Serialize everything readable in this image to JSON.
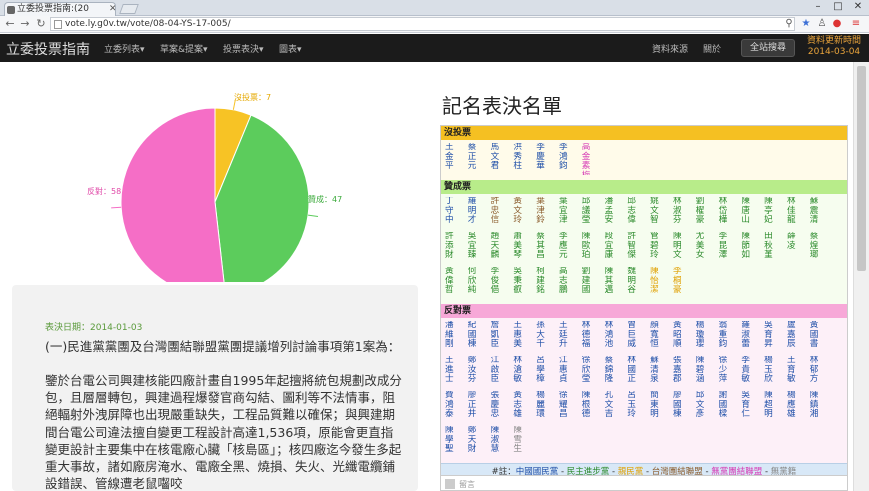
{
  "browser": {
    "tab_title": "立委投票指南:(20",
    "url": "vote.ly.g0v.tw/vote/08-04-YS-17-005/"
  },
  "navbar": {
    "brand": "立委投票指南",
    "menu": [
      "立委列表▾",
      "草案&提案▾",
      "投票表決▾",
      "圖表▾"
    ],
    "data_source": "資料來源",
    "about": "關於",
    "search": "全站搜尋",
    "update_label": "資料更新時間",
    "update_date": "2014-03-04"
  },
  "chart_data": {
    "type": "pie",
    "slices": [
      {
        "label": "沒投票",
        "value": 7,
        "color": "#f7c325"
      },
      {
        "label": "贊成",
        "value": 47,
        "color": "#5ccc5c"
      },
      {
        "label": "反對",
        "value": 58,
        "color": "#f56ec6"
      }
    ],
    "labels_text": [
      "沒投票：7",
      "贊成：47",
      "反對：58"
    ]
  },
  "vote": {
    "date": "表決日期：2014-01-03",
    "title": "(一)民進黨黨團及台灣團結聯盟黨團提議增列討論事項第1案為：",
    "body": "鑒於台電公司興建核能四廠計畫自1995年起擅將統包規劃改成分包，且層層轉包，興建過程爆發官商勾結、圖利等不法情事，阻絕輻射外洩屏障也出現嚴重缺失，工程品質難以確保；與興建期間台電公司違法擅自變更工程設計高達1,536項，原能會更直指變更設計主要集中在核電廠心臟「核島區」；核四廠迄今發生多起重大事故，諸如廠房淹水、電廠全黑、燒損、失火、光纖電纜鋪設錯誤、管線遭老鼠囓咬"
  },
  "roster": {
    "title": "記名表決名單",
    "sections": [
      {
        "label": "沒投票",
        "color": "#f5c022",
        "body_bg": "#fffbea",
        "names": [
          {
            "n": "王金平",
            "p": "kmt"
          },
          {
            "n": "蔡正元",
            "p": "kmt"
          },
          {
            "n": "馬文君",
            "p": "kmt"
          },
          {
            "n": "洪秀柱",
            "p": "kmt"
          },
          {
            "n": "李慶華",
            "p": "kmt"
          },
          {
            "n": "李鴻鈞",
            "p": "kmt"
          },
          {
            "n": "高金素梅",
            "p": "npsu"
          }
        ]
      },
      {
        "label": "贊成票",
        "color": "#b8ec8a",
        "body_bg": "#f6fdef",
        "names": [
          {
            "n": "丁守中",
            "p": "kmt"
          },
          {
            "n": "羅明才",
            "p": "kmt"
          },
          {
            "n": "許忠信",
            "p": "tsu"
          },
          {
            "n": "黃文玲",
            "p": "tsu"
          },
          {
            "n": "葉津鈴",
            "p": "tsu"
          },
          {
            "n": "葉宜津",
            "p": "dpp"
          },
          {
            "n": "邱議瑩",
            "p": "dpp"
          },
          {
            "n": "潘孟安",
            "p": "dpp"
          },
          {
            "n": "邱志偉",
            "p": "dpp"
          },
          {
            "n": "姚文智",
            "p": "dpp"
          },
          {
            "n": "林淑芬",
            "p": "dpp"
          },
          {
            "n": "劉櫂豪",
            "p": "dpp"
          },
          {
            "n": "林岱樺",
            "p": "dpp"
          },
          {
            "n": "陳唐山",
            "p": "dpp"
          },
          {
            "n": "陳亭妃",
            "p": "dpp"
          },
          {
            "n": "林佳龍",
            "p": "dpp"
          },
          {
            "n": "蘇震清",
            "p": "dpp"
          },
          {
            "n": "許添財",
            "p": "dpp"
          },
          {
            "n": "吳宜臻",
            "p": "dpp"
          },
          {
            "n": "趙天麟",
            "p": "dpp"
          },
          {
            "n": "蕭美琴",
            "p": "dpp"
          },
          {
            "n": "蔡其昌",
            "p": "dpp"
          },
          {
            "n": "李應元",
            "p": "dpp"
          },
          {
            "n": "陳歐珀",
            "p": "dpp"
          },
          {
            "n": "段宜康",
            "p": "dpp"
          },
          {
            "n": "許智傑",
            "p": "dpp"
          },
          {
            "n": "管碧玲",
            "p": "dpp"
          },
          {
            "n": "陳明文",
            "p": "dpp"
          },
          {
            "n": "尤美女",
            "p": "dpp"
          },
          {
            "n": "李昆澤",
            "p": "dpp"
          },
          {
            "n": "陳節如",
            "p": "dpp"
          },
          {
            "n": "田秋堇",
            "p": "dpp"
          },
          {
            "n": "薛凌",
            "p": "dpp"
          },
          {
            "n": "蔡煌瑯",
            "p": "dpp"
          },
          {
            "n": "黃偉哲",
            "p": "dpp"
          },
          {
            "n": "何欣純",
            "p": "dpp"
          },
          {
            "n": "李俊俋",
            "p": "dpp"
          },
          {
            "n": "吳秉叡",
            "p": "dpp"
          },
          {
            "n": "柯建銘",
            "p": "dpp"
          },
          {
            "n": "高志鵬",
            "p": "dpp"
          },
          {
            "n": "劉建國",
            "p": "dpp"
          },
          {
            "n": "陳其邁",
            "p": "dpp"
          },
          {
            "n": "魏明谷",
            "p": "dpp"
          },
          {
            "n": "陳怡潔",
            "p": "pfp"
          },
          {
            "n": "李桐豪",
            "p": "pfp"
          }
        ]
      },
      {
        "label": "反對票",
        "color": "#f7a8d8",
        "body_bg": "#fdf0f8",
        "names": [
          {
            "n": "潘維剛",
            "p": "kmt"
          },
          {
            "n": "紀國棟",
            "p": "kmt"
          },
          {
            "n": "詹凱臣",
            "p": "kmt"
          },
          {
            "n": "王惠美",
            "p": "kmt"
          },
          {
            "n": "孫大千",
            "p": "kmt"
          },
          {
            "n": "王廷升",
            "p": "kmt"
          },
          {
            "n": "林德福",
            "p": "kmt"
          },
          {
            "n": "林鴻池",
            "p": "kmt"
          },
          {
            "n": "曾巨威",
            "p": "kmt"
          },
          {
            "n": "顏寬恒",
            "p": "kmt"
          },
          {
            "n": "黃昭順",
            "p": "kmt"
          },
          {
            "n": "楊瓊瓔",
            "p": "kmt"
          },
          {
            "n": "翁重鈞",
            "p": "kmt"
          },
          {
            "n": "羅淑蕾",
            "p": "kmt"
          },
          {
            "n": "吳育昇",
            "p": "kmt"
          },
          {
            "n": "盧嘉辰",
            "p": "kmt"
          },
          {
            "n": "黃國書",
            "p": "kmt"
          },
          {
            "n": "王進士",
            "p": "kmt"
          },
          {
            "n": "鄭汝芬",
            "p": "kmt"
          },
          {
            "n": "江啟臣",
            "p": "kmt"
          },
          {
            "n": "林滄敏",
            "p": "kmt"
          },
          {
            "n": "呂學樟",
            "p": "kmt"
          },
          {
            "n": "江惠貞",
            "p": "kmt"
          },
          {
            "n": "徐欣瑩",
            "p": "kmt"
          },
          {
            "n": "蔡錦隆",
            "p": "kmt"
          },
          {
            "n": "林國正",
            "p": "kmt"
          },
          {
            "n": "蘇清泉",
            "p": "kmt"
          },
          {
            "n": "張嘉郡",
            "p": "kmt"
          },
          {
            "n": "陳碧涵",
            "p": "kmt"
          },
          {
            "n": "徐少萍",
            "p": "kmt"
          },
          {
            "n": "李貴敏",
            "p": "kmt"
          },
          {
            "n": "楊玉欣",
            "p": "kmt"
          },
          {
            "n": "王育敏",
            "p": "kmt"
          },
          {
            "n": "林郁方",
            "p": "kmt"
          },
          {
            "n": "費鴻泰",
            "p": "kmt"
          },
          {
            "n": "廖正井",
            "p": "kmt"
          },
          {
            "n": "張慶忠",
            "p": "kmt"
          },
          {
            "n": "黃志雄",
            "p": "kmt"
          },
          {
            "n": "楊麗環",
            "p": "kmt"
          },
          {
            "n": "徐耀昌",
            "p": "kmt"
          },
          {
            "n": "陳根德",
            "p": "kmt"
          },
          {
            "n": "孔文吉",
            "p": "kmt"
          },
          {
            "n": "呂玉玲",
            "p": "kmt"
          },
          {
            "n": "簡東明",
            "p": "kmt"
          },
          {
            "n": "廖國棟",
            "p": "kmt"
          },
          {
            "n": "邱文彥",
            "p": "kmt"
          },
          {
            "n": "謝國樑",
            "p": "kmt"
          },
          {
            "n": "吳育仁",
            "p": "kmt"
          },
          {
            "n": "陳超明",
            "p": "kmt"
          },
          {
            "n": "楊應雄",
            "p": "kmt"
          },
          {
            "n": "陳鎮湘",
            "p": "kmt"
          },
          {
            "n": "陳學聖",
            "p": "kmt"
          },
          {
            "n": "鄭天財",
            "p": "kmt"
          },
          {
            "n": "陳淑慧",
            "p": "kmt"
          },
          {
            "n": "陳雪生",
            "p": "none"
          }
        ]
      }
    ],
    "legend": {
      "prefix": "#註：",
      "items": [
        {
          "text": "中國國民黨",
          "p": "kmt"
        },
        {
          "text": "民主進步黨",
          "p": "dpp"
        },
        {
          "text": "親民黨",
          "p": "pfp"
        },
        {
          "text": "台灣團結聯盟",
          "p": "tsu"
        },
        {
          "text": "無黨團結聯盟",
          "p": "npsu"
        },
        {
          "text": "無黨籍",
          "p": "none"
        }
      ],
      "sep": " - "
    },
    "comment_placeholder": "留言"
  }
}
